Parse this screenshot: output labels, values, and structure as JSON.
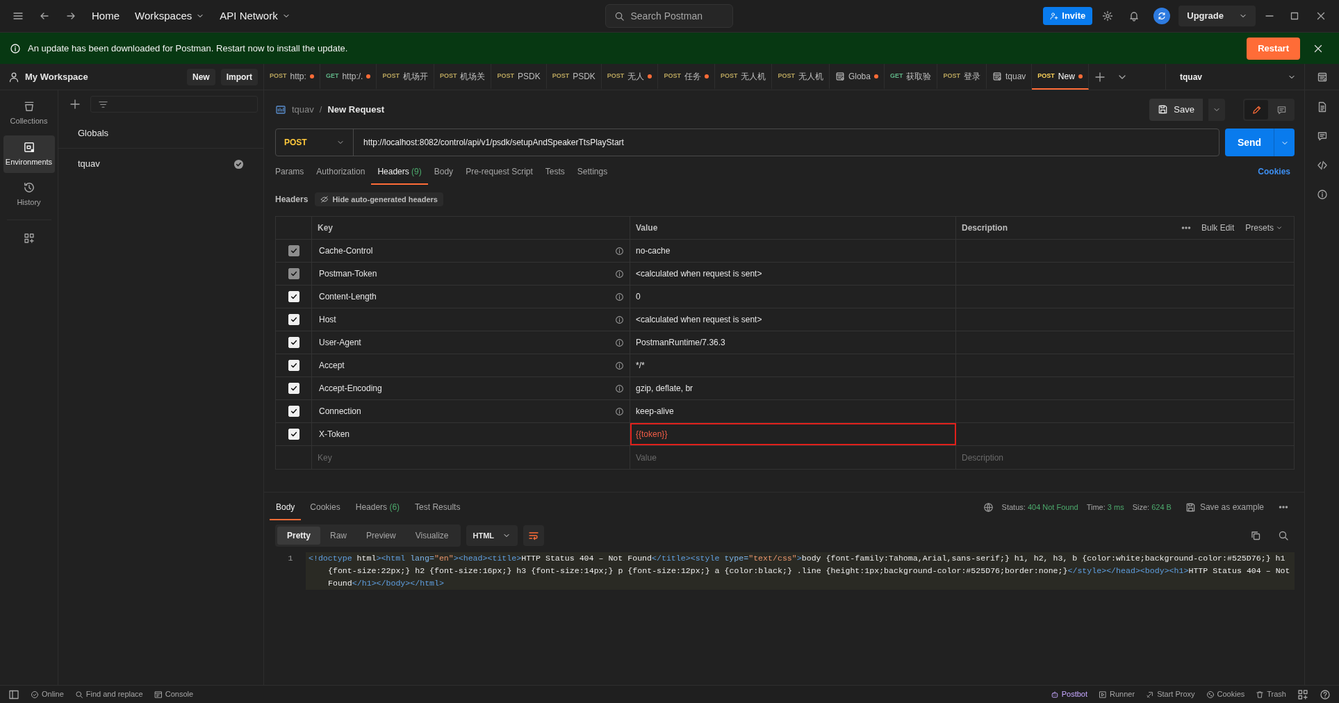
{
  "topbar": {
    "nav": [
      {
        "label": "Home",
        "dropdown": false
      },
      {
        "label": "Workspaces",
        "dropdown": true
      },
      {
        "label": "API Network",
        "dropdown": true
      }
    ],
    "search_placeholder": "Search Postman",
    "invite": "Invite",
    "upgrade": "Upgrade"
  },
  "banner": {
    "message": "An update has been downloaded for Postman. Restart now to install the update.",
    "button": "Restart"
  },
  "workspace": {
    "name": "My Workspace",
    "buttons": [
      "New",
      "Import"
    ]
  },
  "sidebar": {
    "items": [
      {
        "label": "Collections",
        "kind": "collections",
        "selected": false
      },
      {
        "label": "Environments",
        "kind": "environments",
        "selected": true
      },
      {
        "label": "History",
        "kind": "history",
        "selected": false
      }
    ]
  },
  "environments": [
    {
      "name": "Globals",
      "active": false
    },
    {
      "name": "tquav",
      "active": true
    }
  ],
  "tabs": [
    {
      "kind": "post",
      "method": "POST",
      "label": "http:",
      "unsaved": true,
      "selected": false
    },
    {
      "kind": "get",
      "method": "GET",
      "label": "http:/.",
      "unsaved": true,
      "selected": false
    },
    {
      "kind": "post",
      "method": "POST",
      "label": "机场开",
      "unsaved": false,
      "selected": false
    },
    {
      "kind": "post",
      "method": "POST",
      "label": "机场关",
      "unsaved": false,
      "selected": false
    },
    {
      "kind": "post",
      "method": "POST",
      "label": "PSDK",
      "unsaved": false,
      "selected": false
    },
    {
      "kind": "post",
      "method": "POST",
      "label": "PSDK",
      "unsaved": false,
      "selected": false
    },
    {
      "kind": "post",
      "method": "POST",
      "label": "无人",
      "unsaved": true,
      "selected": false
    },
    {
      "kind": "post",
      "method": "POST",
      "label": "任务",
      "unsaved": true,
      "selected": false
    },
    {
      "kind": "post",
      "method": "POST",
      "label": "无人机",
      "unsaved": false,
      "selected": false
    },
    {
      "kind": "post",
      "method": "POST",
      "label": "无人机",
      "unsaved": false,
      "selected": false
    },
    {
      "kind": "environment",
      "label": "Globa",
      "unsaved": true,
      "selected": false
    },
    {
      "kind": "get",
      "method": "GET",
      "label": "获取验",
      "unsaved": false,
      "selected": false
    },
    {
      "kind": "post",
      "method": "POST",
      "label": "登录",
      "unsaved": false,
      "selected": false
    },
    {
      "kind": "environment",
      "label": "tquav",
      "unsaved": false,
      "selected": false
    },
    {
      "kind": "post",
      "method": "POST",
      "label": "New",
      "unsaved": true,
      "selected": true
    }
  ],
  "environment_selector": "tquav",
  "request": {
    "breadcrumb": [
      "tquav",
      "New Request"
    ],
    "separator": "/",
    "save": "Save",
    "modes": [
      {
        "kind": "edit",
        "selected": true
      },
      {
        "kind": "comment",
        "selected": false
      }
    ],
    "method": "POST",
    "url": "http://localhost:8082/control/api/v1/psdk/setupAndSpeakerTtsPlayStart",
    "send": "Send",
    "tabs": [
      {
        "label": "Params",
        "selected": false
      },
      {
        "label": "Authorization",
        "selected": false
      },
      {
        "label": "Headers",
        "count": "(9)",
        "selected": true
      },
      {
        "label": "Body",
        "selected": false
      },
      {
        "label": "Pre-request Script",
        "selected": false
      },
      {
        "label": "Tests",
        "selected": false
      },
      {
        "label": "Settings",
        "selected": false
      }
    ],
    "cookies": "Cookies",
    "headers_title": "Headers",
    "hide_button": "Hide auto-generated headers",
    "table": {
      "columns": [
        "Key",
        "Value",
        "Description"
      ],
      "actions": [
        "Bulk Edit",
        "Presets"
      ],
      "rows": [
        {
          "key": "Cache-Control",
          "value": "no-cache",
          "checked": true,
          "disabled": true,
          "auto": true,
          "variable": false,
          "highlighted": false
        },
        {
          "key": "Postman-Token",
          "value": "<calculated when request is sent>",
          "checked": true,
          "disabled": true,
          "auto": true,
          "variable": false,
          "highlighted": false
        },
        {
          "key": "Content-Length",
          "value": "0",
          "checked": true,
          "disabled": false,
          "auto": true,
          "variable": false,
          "highlighted": false
        },
        {
          "key": "Host",
          "value": "<calculated when request is sent>",
          "checked": true,
          "disabled": false,
          "auto": true,
          "variable": false,
          "highlighted": false
        },
        {
          "key": "User-Agent",
          "value": "PostmanRuntime/7.36.3",
          "checked": true,
          "disabled": false,
          "auto": true,
          "variable": false,
          "highlighted": false
        },
        {
          "key": "Accept",
          "value": "*/*",
          "checked": true,
          "disabled": false,
          "auto": true,
          "variable": false,
          "highlighted": false
        },
        {
          "key": "Accept-Encoding",
          "value": "gzip, deflate, br",
          "checked": true,
          "disabled": false,
          "auto": true,
          "variable": false,
          "highlighted": false
        },
        {
          "key": "Connection",
          "value": "keep-alive",
          "checked": true,
          "disabled": false,
          "auto": true,
          "variable": false,
          "highlighted": false
        },
        {
          "key": "X-Token",
          "value": "{{token}}",
          "checked": true,
          "disabled": false,
          "auto": false,
          "variable": true,
          "highlighted": true
        }
      ],
      "placeholders": [
        "Key",
        "Value",
        "Description"
      ]
    }
  },
  "response": {
    "tabs": [
      {
        "label": "Body",
        "selected": true
      },
      {
        "label": "Cookies",
        "selected": false
      },
      {
        "label": "Headers",
        "count": "(6)",
        "selected": false
      },
      {
        "label": "Test Results",
        "selected": false
      }
    ],
    "status": {
      "label": "Status:",
      "value": "404 Not Found"
    },
    "time": {
      "label": "Time:",
      "value": "3 ms"
    },
    "size": {
      "label": "Size:",
      "value": "624 B"
    },
    "save_example": "Save as example",
    "views": [
      {
        "label": "Pretty",
        "selected": true
      },
      {
        "label": "Raw",
        "selected": false
      },
      {
        "label": "Preview",
        "selected": false
      },
      {
        "label": "Visualize",
        "selected": false
      }
    ],
    "format": "HTML",
    "wrap": true,
    "code": [
      {
        "number": "1",
        "segments": [
          {
            "kind": "tag",
            "text": "<!doctype"
          },
          {
            "kind": "text",
            "text": " html"
          },
          {
            "kind": "tag",
            "text": "><html "
          },
          {
            "kind": "attr",
            "text": "lang="
          },
          {
            "kind": "string",
            "text": "\"en\""
          },
          {
            "kind": "tag",
            "text": "><head><title>"
          },
          {
            "kind": "text",
            "text": "HTTP Status 404 – Not Found"
          },
          {
            "kind": "tag",
            "text": "</title><style "
          },
          {
            "kind": "attr",
            "text": "type="
          },
          {
            "kind": "string",
            "text": "\"text/css\""
          },
          {
            "kind": "tag",
            "text": ">"
          },
          {
            "kind": "text",
            "text": "body {font-family:Tahoma,Arial,sans-serif;} h1, h2, h3, b {color:white;background-color:#525D76;} h1 {font-size:22px;} h2 {font-size:16px;} h3 {font-size:14px;} p {font-size:12px;} a {color:black;} .line {height:1px;background-color:#525D76;border:none;}"
          },
          {
            "kind": "tag",
            "text": "</style></head><body><h1>"
          },
          {
            "kind": "text",
            "text": "HTTP Status 404 – Not Found"
          },
          {
            "kind": "tag",
            "text": "</h1></body></html>"
          }
        ]
      }
    ]
  },
  "status_bar": {
    "left": [
      "Online",
      "Find and replace",
      "Console"
    ],
    "right": [
      "Postbot",
      "Runner",
      "Start Proxy",
      "Cookies",
      "Trash"
    ]
  }
}
